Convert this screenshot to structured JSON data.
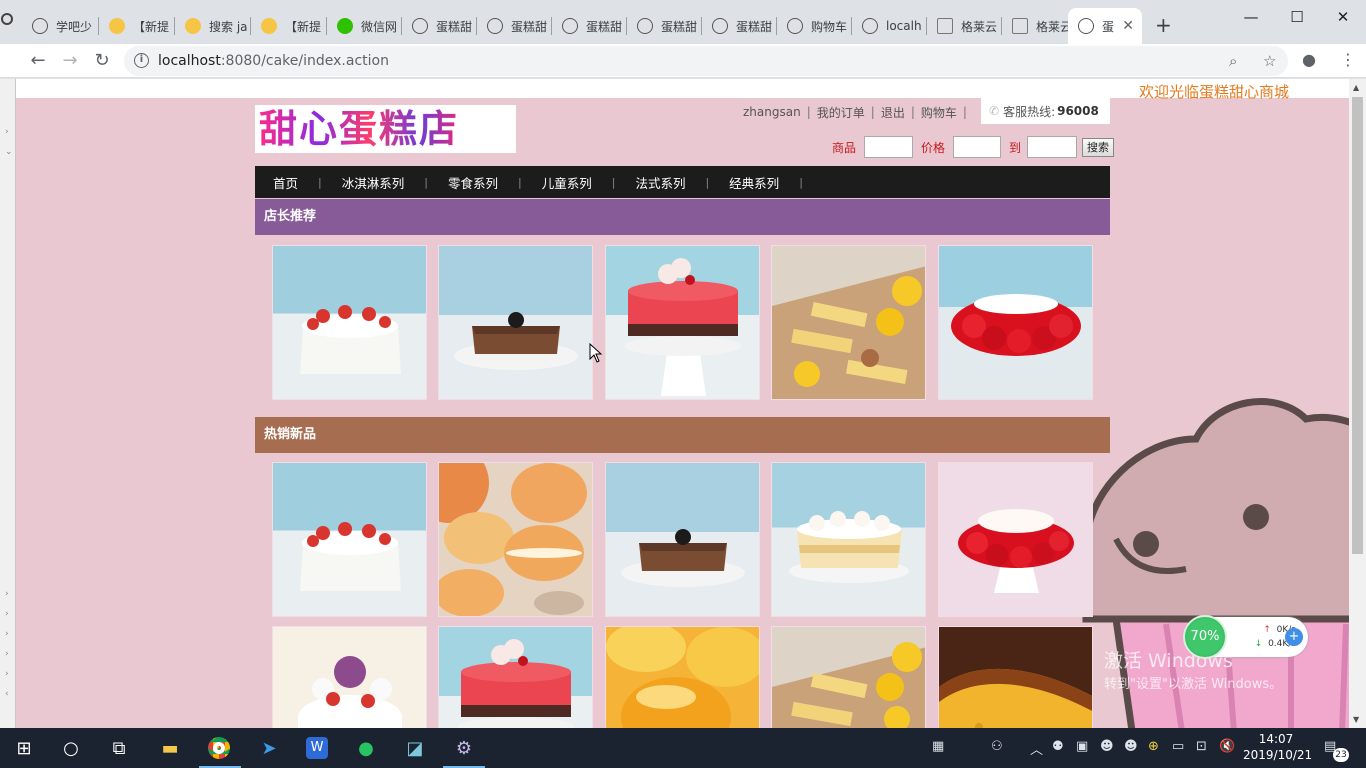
{
  "browser": {
    "tabs": [
      {
        "label": "学吧少",
        "icon": "globe-icon"
      },
      {
        "label": "【新提",
        "icon": "cat-icon"
      },
      {
        "label": "搜索 ja",
        "icon": "cat-icon"
      },
      {
        "label": "【新提",
        "icon": "cat-icon"
      },
      {
        "label": "微信网",
        "icon": "wechat-icon"
      },
      {
        "label": "蛋糕甜",
        "icon": "globe-icon"
      },
      {
        "label": "蛋糕甜",
        "icon": "globe-icon"
      },
      {
        "label": "蛋糕甜",
        "icon": "globe-icon"
      },
      {
        "label": "蛋糕甜",
        "icon": "globe-icon"
      },
      {
        "label": "蛋糕甜",
        "icon": "globe-icon"
      },
      {
        "label": "购物车",
        "icon": "globe-icon"
      },
      {
        "label": "localh",
        "icon": "globe-icon"
      },
      {
        "label": "格莱云",
        "icon": "doc-icon"
      },
      {
        "label": "格莱云",
        "icon": "doc-icon"
      },
      {
        "label": "蛋",
        "icon": "globe-icon",
        "active": true
      }
    ],
    "url_host": "localhost",
    "url_path": ":8080/cake/index.action"
  },
  "page": {
    "welcome": "欢迎光临蛋糕甜心商城",
    "logo_text": "甜心蛋糕店",
    "user": {
      "username": "zhangsan",
      "sep": "|",
      "links": [
        "我的订单",
        "退出",
        "购物车"
      ]
    },
    "hotline": {
      "label": "客服热线:",
      "number": "96008"
    },
    "search": {
      "goods_label": "商品",
      "price_label": "价格",
      "to_label": "到",
      "button": "搜索"
    },
    "nav": [
      "首页",
      "冰淇淋系列",
      "零食系列",
      "儿童系列",
      "法式系列",
      "经典系列"
    ],
    "nav_sep": "|",
    "sections": {
      "recommend": {
        "title": "店长推荐",
        "color": "#875a98"
      },
      "hot": {
        "title": "热销新品",
        "color": "#a76d50"
      }
    }
  },
  "watermark": {
    "line1": "激活 Windows",
    "line2": "转到\"设置\"以激活 Windows。"
  },
  "speed_widget": {
    "percent": "70%",
    "up": "0K/s",
    "down": "0.4K/s"
  },
  "taskbar": {
    "time": "14:07",
    "date": "2019/10/21",
    "notifications": "23"
  },
  "colors": {
    "page_bg": "#e9c8d2",
    "nav_bg": "#1c1c1c",
    "welcome": "#e47b1f",
    "search_labels": "#c41b1b"
  }
}
